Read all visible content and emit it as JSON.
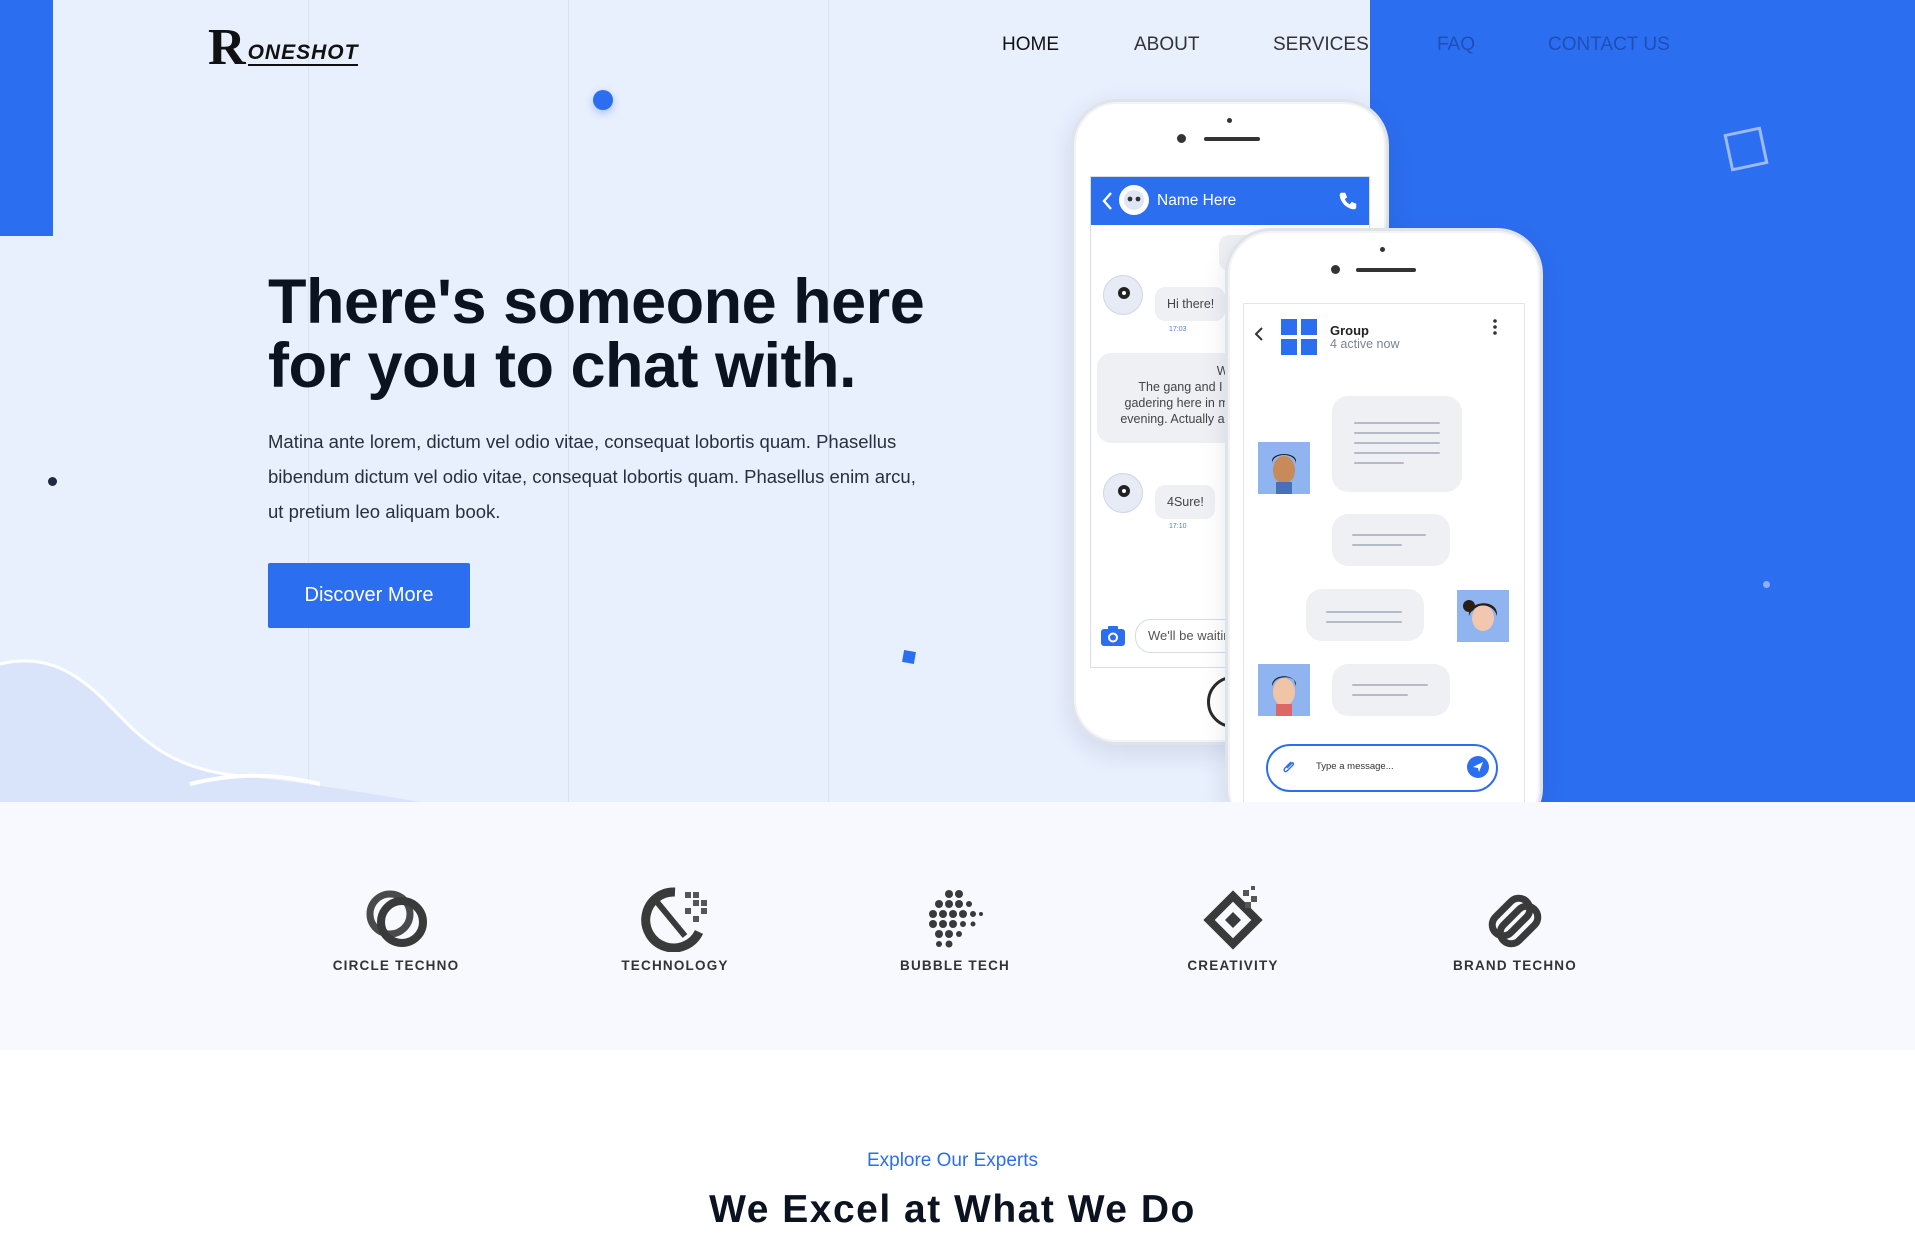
{
  "brand": {
    "logo_letter": "R",
    "logo_rest": "ONESHOT"
  },
  "nav": {
    "items": [
      "HOME",
      "ABOUT",
      "SERVICES",
      "FAQ",
      "CONTACT US"
    ]
  },
  "hero": {
    "headline_line1": "There's someone here",
    "headline_line2": "for you to chat with.",
    "lead_line1": "Matina ante lorem, dictum vel odio vitae, consequat lobortis quam. Phasellus",
    "lead_line2": "bibendum dictum vel odio vitae, consequat lobortis quam. Phasellus enim arcu,",
    "lead_line3": "ut pretium leo aliquam book.",
    "cta_label": "Discover More"
  },
  "phone_back": {
    "contact_name": "Name Here",
    "msg1": "Hi there!",
    "time1": "17:03",
    "msg2_line1": "Wa",
    "msg2_line2": "The gang and I w",
    "msg2_line3": "gadering here in my",
    "msg2_line4": "evening. Actually arc",
    "msg3": "4Sure!",
    "time3": "17:10",
    "input_text": "We'll be waitir"
  },
  "phone_front": {
    "group_title": "Group",
    "group_subtitle": "4 active now",
    "input_placeholder": "Type a message..."
  },
  "brands": [
    "CIRCLE TECHNO",
    "TECHNOLOGY",
    "BUBBLE TECH",
    "CREATIVITY",
    "BRAND TECHNO"
  ],
  "section": {
    "kicker": "Explore Our Experts",
    "title": "We Excel at What We Do"
  },
  "colors": {
    "accent": "#2c6ef0",
    "hero_bg": "#e8effd",
    "heading": "#0b1220"
  }
}
